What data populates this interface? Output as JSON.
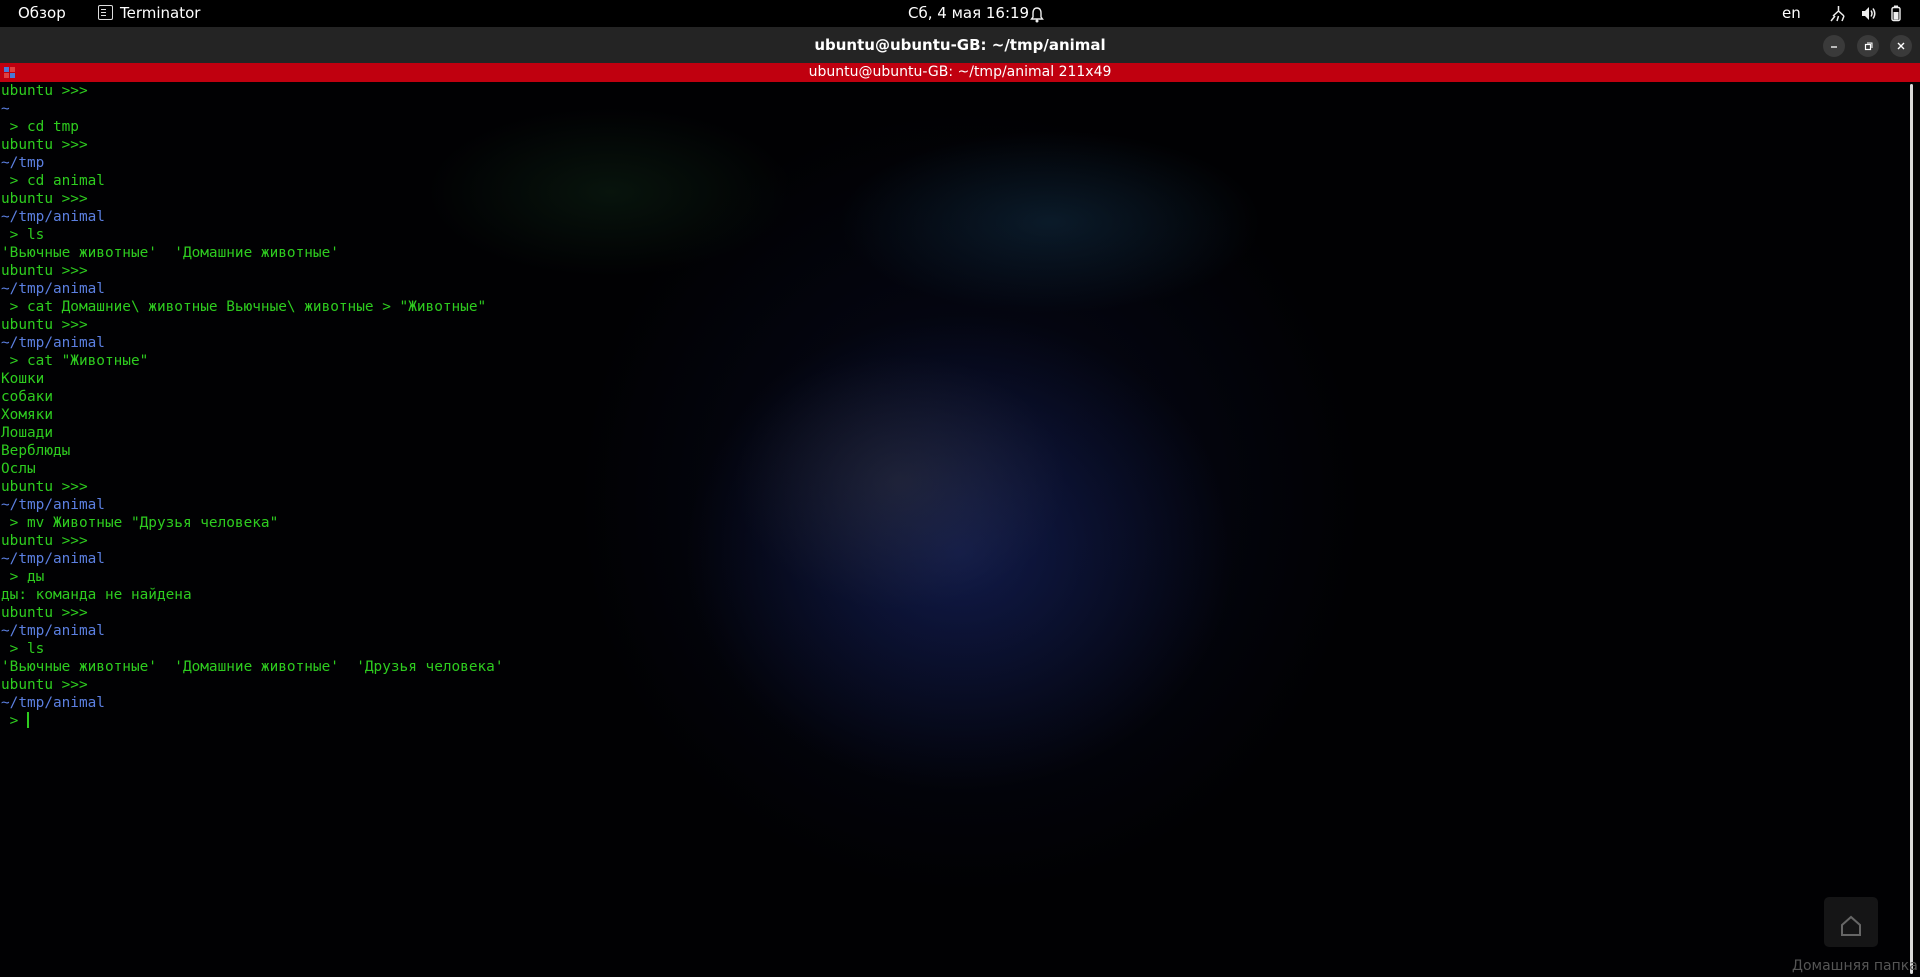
{
  "topbar": {
    "overview": "Обзор",
    "app_name": "Terminator",
    "clock": "Сб, 4 мая  16:19",
    "lang": "en"
  },
  "window": {
    "title": "ubuntu@ubuntu-GB: ~/tmp/animal"
  },
  "terminal": {
    "header": "ubuntu@ubuntu-GB: ~/tmp/animal 211x49",
    "lines": [
      {
        "type": "prompt",
        "text": "ubuntu >>>"
      },
      {
        "type": "path",
        "text": "~"
      },
      {
        "type": "cmd",
        "text": " > cd tmp"
      },
      {
        "type": "prompt",
        "text": "ubuntu >>>"
      },
      {
        "type": "path",
        "text": "~/tmp"
      },
      {
        "type": "cmd",
        "text": " > cd animal"
      },
      {
        "type": "prompt",
        "text": "ubuntu >>>"
      },
      {
        "type": "path",
        "text": "~/tmp/animal"
      },
      {
        "type": "cmd",
        "text": " > ls"
      },
      {
        "type": "out",
        "text": "'Вьючные животные'  'Домашние животные'"
      },
      {
        "type": "prompt",
        "text": "ubuntu >>>"
      },
      {
        "type": "path",
        "text": "~/tmp/animal"
      },
      {
        "type": "cmd",
        "text": " > cat Домашние\\ животные Вьючные\\ животные > \"Животные\""
      },
      {
        "type": "prompt",
        "text": "ubuntu >>>"
      },
      {
        "type": "path",
        "text": "~/tmp/animal"
      },
      {
        "type": "cmd",
        "text": " > cat \"Животные\""
      },
      {
        "type": "out",
        "text": "Кошки"
      },
      {
        "type": "out",
        "text": "собаки"
      },
      {
        "type": "out",
        "text": "Хомяки"
      },
      {
        "type": "out",
        "text": "Лошади"
      },
      {
        "type": "out",
        "text": "Верблюды"
      },
      {
        "type": "out",
        "text": "Ослы"
      },
      {
        "type": "prompt",
        "text": "ubuntu >>>"
      },
      {
        "type": "path",
        "text": "~/tmp/animal"
      },
      {
        "type": "cmd",
        "text": " > mv Животные \"Друзья человека\""
      },
      {
        "type": "prompt",
        "text": "ubuntu >>>"
      },
      {
        "type": "path",
        "text": "~/tmp/animal"
      },
      {
        "type": "cmd",
        "text": " > ды"
      },
      {
        "type": "out",
        "text": "ды: команда не найдена"
      },
      {
        "type": "prompt",
        "text": "ubuntu >>>"
      },
      {
        "type": "path",
        "text": "~/tmp/animal"
      },
      {
        "type": "cmd",
        "text": " > ls"
      },
      {
        "type": "out",
        "text": "'Вьючные животные'  'Домашние животные'  'Друзья человека'"
      },
      {
        "type": "prompt",
        "text": "ubuntu >>>"
      },
      {
        "type": "path",
        "text": "~/tmp/animal"
      }
    ],
    "current_input": " > "
  },
  "desktop": {
    "home_folder_label": "Домашняя папка"
  },
  "icons": {
    "bell": "bell-icon",
    "network": "network-icon",
    "volume": "volume-icon",
    "battery": "battery-icon",
    "minimize": "minimize-icon",
    "maximize": "maximize-icon",
    "close": "close-icon",
    "home": "home-icon"
  },
  "colors": {
    "prompt": "#2ecc1f",
    "path": "#5b7fe0",
    "header_bar": "#c0000f"
  }
}
